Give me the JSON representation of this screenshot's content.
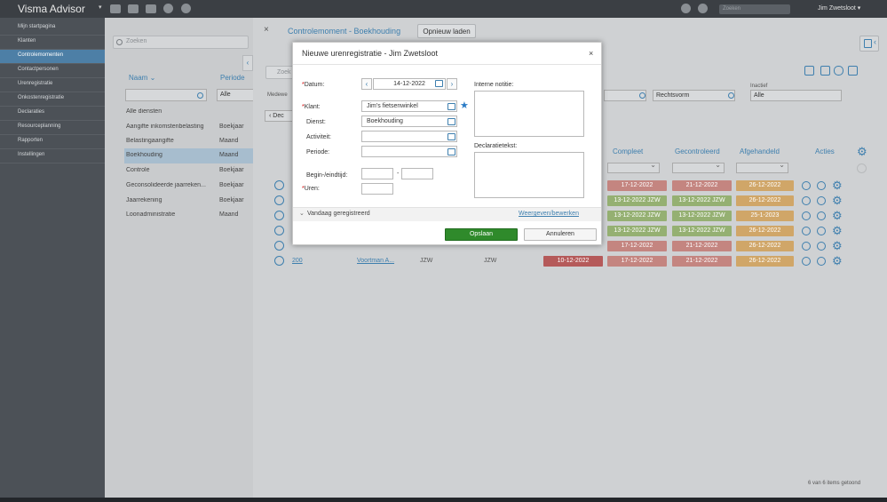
{
  "topbar": {
    "app_title": "Visma Advisor",
    "search_placeholder": "Zoeken",
    "user": "Jim Zwetsloot"
  },
  "sidebar": {
    "items": [
      {
        "label": "Mijn startpagina"
      },
      {
        "label": "Klanten"
      },
      {
        "label": "Controlemomenten",
        "active": true
      },
      {
        "label": "Contactpersonen"
      },
      {
        "label": "Urenregistratie"
      },
      {
        "label": "Onkostenregistratie"
      },
      {
        "label": "Declaraties"
      },
      {
        "label": "Resourceplanning"
      },
      {
        "label": "Rapporten"
      },
      {
        "label": "Instellingen"
      }
    ]
  },
  "list": {
    "search_placeholder": "Zoeken",
    "col_name": "Naam",
    "col_period": "Periode",
    "filter_period": "Alle",
    "rows": [
      {
        "name": "Alle diensten",
        "period": ""
      },
      {
        "name": "Aangifte inkomstenbelasting",
        "period": "Boekjaar"
      },
      {
        "name": "Belastingaangifte",
        "period": "Maand"
      },
      {
        "name": "Boekhouding",
        "period": "Maand"
      },
      {
        "name": "Controle",
        "period": "Boekjaar"
      },
      {
        "name": "Geconsolideerde jaarreken...",
        "period": "Boekjaar"
      },
      {
        "name": "Jaarrekening",
        "period": "Boekjaar"
      },
      {
        "name": "Loonadministratie",
        "period": "Maand"
      }
    ]
  },
  "main": {
    "title": "Controlemoment - Boekhouding",
    "reload_label": "Opnieuw laden",
    "search_placeholder": "Zoek",
    "filters": {
      "medew_label": "Medewe",
      "rechtsvorm": "Rechtsvorm",
      "inactief_label": "Inactief",
      "inactief_value": "Alle",
      "dec_label": "Dec"
    },
    "columns": {
      "compleet": "Compleet",
      "gecontroleerd": "Gecontroleerd",
      "afgehandeld": "Afgehandeld",
      "acties": "Acties"
    },
    "rows": [
      {
        "id": "",
        "client": "",
        "c1": "",
        "c2": "",
        "d0": "",
        "d1": "17-12-2022",
        "d2": "21-12-2022",
        "d3": "26-12-2022",
        "s1": "red",
        "s2": "red",
        "s3": "orange"
      },
      {
        "id": "",
        "client": "",
        "c1": "",
        "c2": "",
        "d0": "",
        "d1": "13-12-2022 JZW",
        "d2": "13-12-2022 JZW",
        "d3": "26-12-2022",
        "s1": "green",
        "s2": "green",
        "s3": "orange"
      },
      {
        "id": "",
        "client": "",
        "c1": "",
        "c2": "",
        "d0": "",
        "d1": "13-12-2022 JZW",
        "d2": "13-12-2022 JZW",
        "d3": "25-1-2023",
        "s1": "green",
        "s2": "green",
        "s3": "orange"
      },
      {
        "id": "",
        "client": "",
        "c1": "",
        "c2": "",
        "d0": "",
        "d1": "13-12-2022 JZW",
        "d2": "13-12-2022 JZW",
        "d3": "26-12-2022",
        "s1": "green",
        "s2": "green",
        "s3": "orange"
      },
      {
        "id": "",
        "client": "",
        "c1": "",
        "c2": "",
        "d0": "",
        "d1": "17-12-2022",
        "d2": "21-12-2022",
        "d3": "26-12-2022",
        "s1": "red",
        "s2": "red",
        "s3": "orange"
      },
      {
        "id": "200",
        "client": "Voortman A...",
        "c1": "JZW",
        "c2": "JZW",
        "d0": "10-12-2022",
        "d1": "17-12-2022",
        "d2": "21-12-2022",
        "d3": "26-12-2022",
        "s1": "red",
        "s2": "red",
        "s3": "orange"
      }
    ],
    "footer": "6 van 6 items getoond"
  },
  "dialog": {
    "title": "Nieuwe urenregistratie - Jim Zwetsloot",
    "close": "×",
    "datum_label": "Datum:",
    "datum_value": "14-12-2022",
    "klant_label": "Klant:",
    "klant_value": "Jim's fietsenwinkel",
    "dienst_label": "Dienst:",
    "dienst_value": "Boekhouding",
    "activiteit_label": "Activiteit:",
    "periode_label": "Periode:",
    "tijd_label": "Begin-/eindtijd:",
    "tijd_sep": "-",
    "uren_label": "Uren:",
    "notitie_label": "Interne notitie:",
    "declaratie_label": "Declaratietekst:",
    "today_label": "Vandaag geregistreerd",
    "view_link": "Weergeven/bewerken",
    "save": "Opslaan",
    "cancel": "Annuleren",
    "required_mark": "*"
  },
  "colors": {
    "accent": "#3e7fae",
    "save": "#2f8a2b",
    "red": "#c48580",
    "green": "#95b072",
    "orange": "#d0a668"
  }
}
